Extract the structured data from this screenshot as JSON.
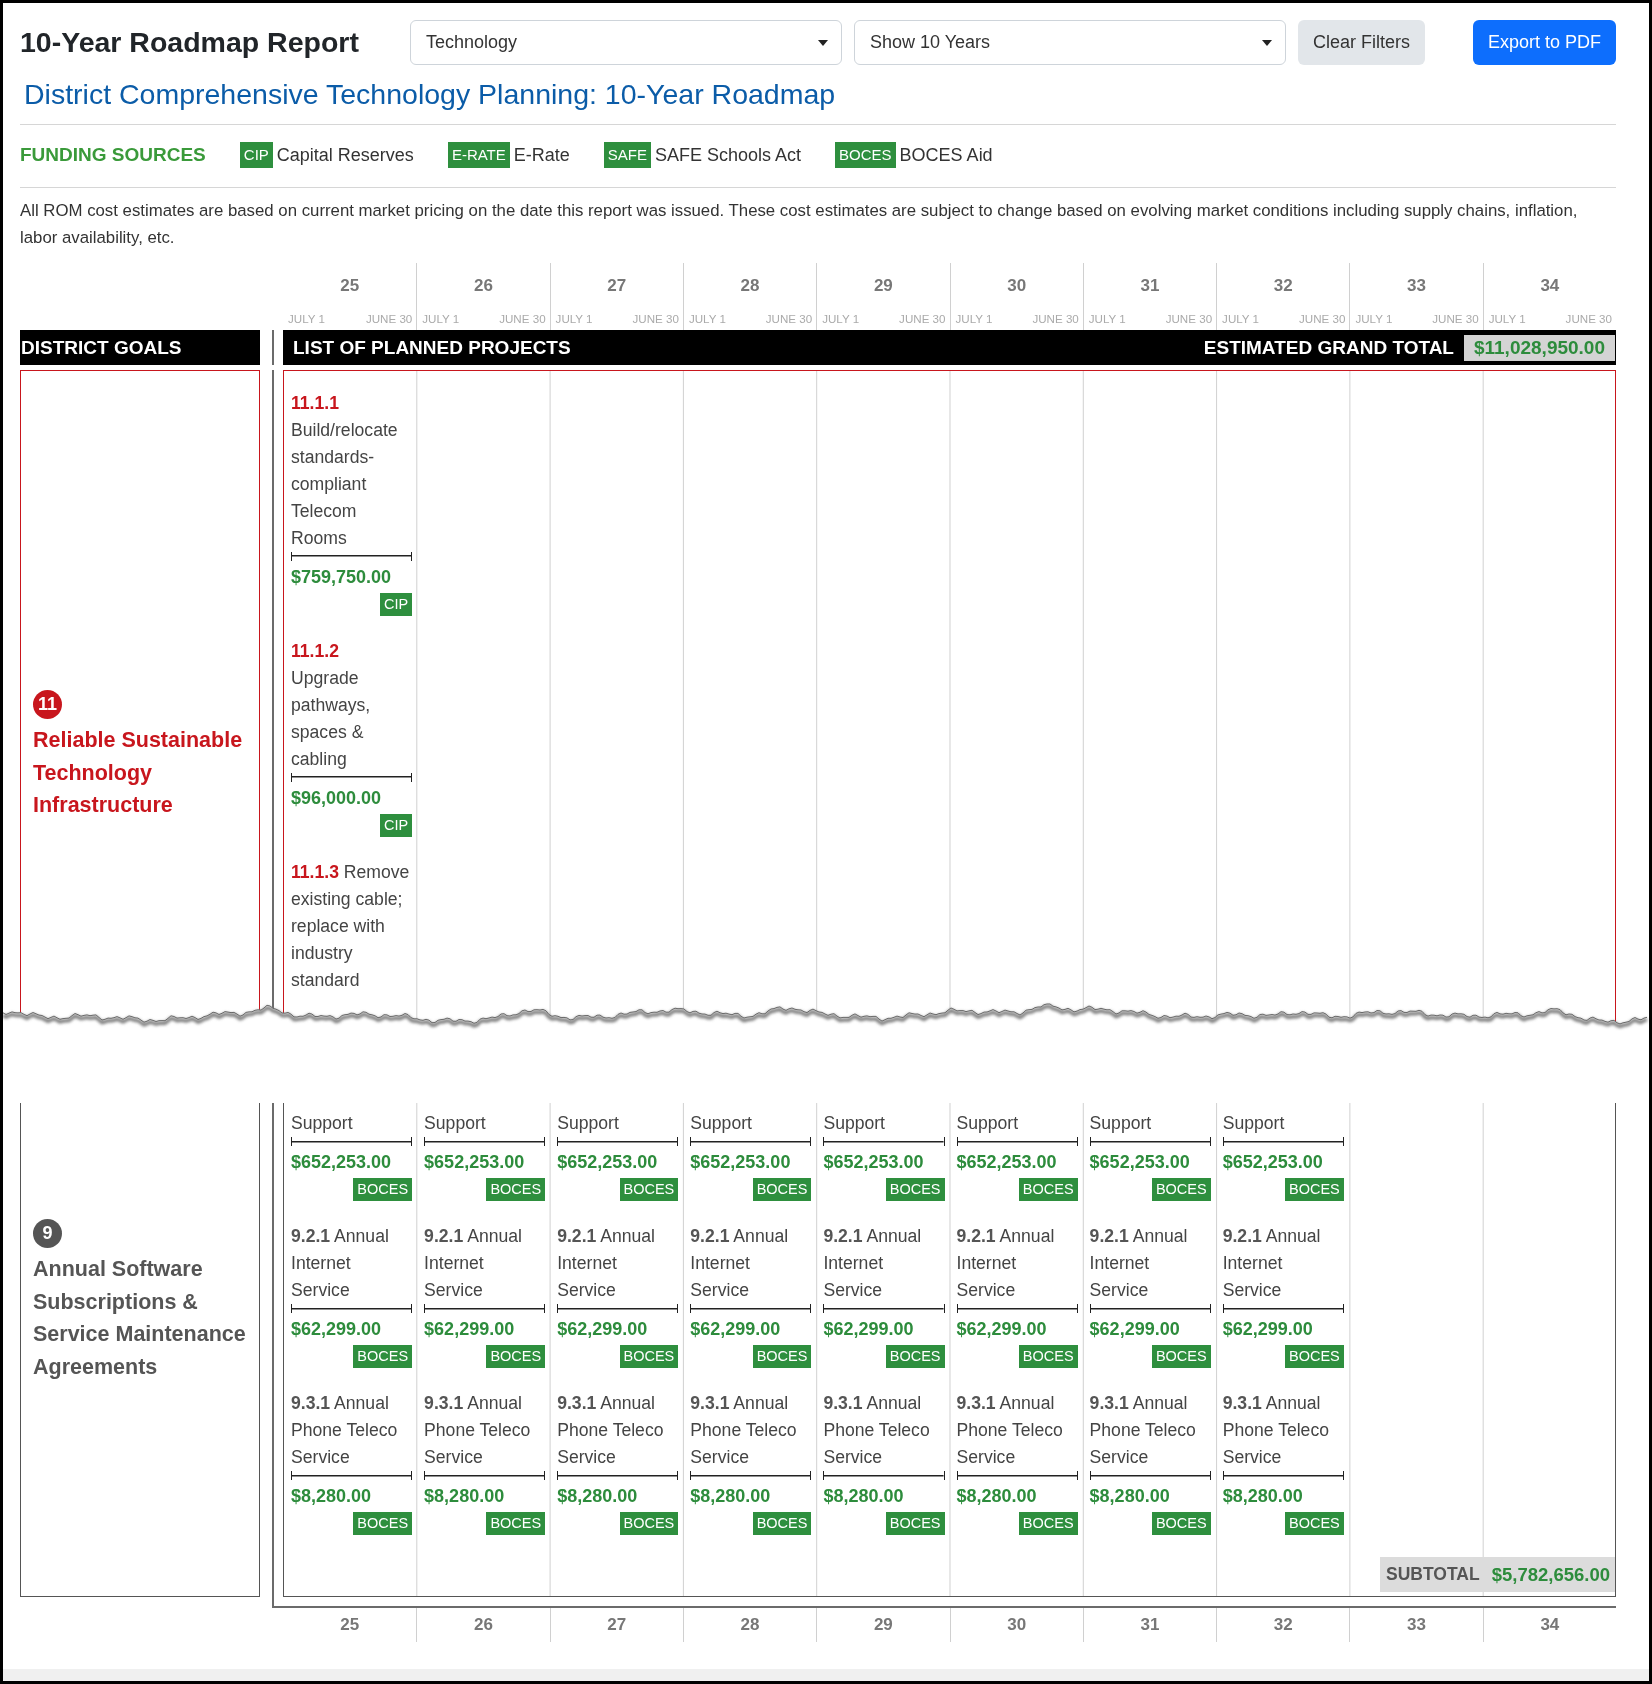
{
  "header": {
    "title": "10-Year Roadmap Report",
    "filters": [
      {
        "value": "Technology"
      },
      {
        "value": "Show 10 Years"
      }
    ],
    "buttons": [
      {
        "label": "Clear Filters",
        "kind": "secondary"
      },
      {
        "label": "Export to PDF",
        "kind": "primary"
      }
    ]
  },
  "subtitle": "District Comprehensive Technology Planning: 10-Year Roadmap",
  "funding_sources": {
    "heading": "FUNDING SOURCES",
    "items": [
      {
        "code": "CIP",
        "name": "Capital Reserves"
      },
      {
        "code": "E-RATE",
        "name": "E-Rate"
      },
      {
        "code": "SAFE",
        "name": "SAFE Schools Act"
      },
      {
        "code": "BOCES",
        "name": "BOCES Aid"
      }
    ]
  },
  "disclaimer": "All ROM cost estimates are based on current market pricing on the date this report was issued. These cost estimates are subject to change based on evolving market conditions including supply chains, inflation, labor availability, etc.",
  "timeline": [
    {
      "year": "25",
      "start": "JULY 1",
      "end": "JUNE 30"
    },
    {
      "year": "26",
      "start": "JULY 1",
      "end": "JUNE 30"
    },
    {
      "year": "27",
      "start": "JULY 1",
      "end": "JUNE 30"
    },
    {
      "year": "28",
      "start": "JULY 1",
      "end": "JUNE 30"
    },
    {
      "year": "29",
      "start": "JULY 1",
      "end": "JUNE 30"
    },
    {
      "year": "30",
      "start": "JULY 1",
      "end": "JUNE 30"
    },
    {
      "year": "31",
      "start": "JULY 1",
      "end": "JUNE 30"
    },
    {
      "year": "32",
      "start": "JULY 1",
      "end": "JUNE 30"
    },
    {
      "year": "33",
      "start": "JULY 1",
      "end": "JUNE 30"
    },
    {
      "year": "34",
      "start": "JULY 1",
      "end": "JUNE 30"
    }
  ],
  "table_header": {
    "goals_heading": "DISTRICT GOALS",
    "projects_heading": "LIST OF PLANNED PROJECTS",
    "grand_total_label": "ESTIMATED GRAND TOTAL",
    "grand_total": "$11,028,950.00"
  },
  "goals": [
    {
      "number": "11",
      "title": "Reliable Sustainable Technology Infrastructure",
      "color": "#c8161d",
      "columns": [
        {
          "projects": [
            {
              "id": "11.1.1",
              "title": "Build/relocate standards-compliant Telecom Rooms",
              "cost": "$759,750.00",
              "source": "CIP"
            },
            {
              "id": "11.1.2",
              "title": "Upgrade pathways, spaces & cabling",
              "cost": "$96,000.00",
              "source": "CIP"
            },
            {
              "id": "11.1.3",
              "title": "Remove existing cable; replace with industry standard"
            }
          ]
        }
      ]
    },
    {
      "number": "9",
      "title": "Annual Software Subscriptions & Service Maintenance Agreements",
      "color": "#555555",
      "columns": [
        {
          "projects": [
            {
              "title": "Support",
              "cost": "$652,253.00",
              "source": "BOCES"
            },
            {
              "id": "9.2.1",
              "title": "Annual Internet Service",
              "cost": "$62,299.00",
              "source": "BOCES"
            },
            {
              "id": "9.3.1",
              "title": "Annual Phone Teleco Service",
              "cost": "$8,280.00",
              "source": "BOCES"
            }
          ]
        },
        {
          "projects": [
            {
              "title": "Support",
              "cost": "$652,253.00",
              "source": "BOCES"
            },
            {
              "id": "9.2.1",
              "title": "Annual Internet Service",
              "cost": "$62,299.00",
              "source": "BOCES"
            },
            {
              "id": "9.3.1",
              "title": "Annual Phone Teleco Service",
              "cost": "$8,280.00",
              "source": "BOCES"
            }
          ]
        },
        {
          "projects": [
            {
              "title": "Support",
              "cost": "$652,253.00",
              "source": "BOCES"
            },
            {
              "id": "9.2.1",
              "title": "Annual Internet Service",
              "cost": "$62,299.00",
              "source": "BOCES"
            },
            {
              "id": "9.3.1",
              "title": "Annual Phone Teleco Service",
              "cost": "$8,280.00",
              "source": "BOCES"
            }
          ]
        },
        {
          "projects": [
            {
              "title": "Support",
              "cost": "$652,253.00",
              "source": "BOCES"
            },
            {
              "id": "9.2.1",
              "title": "Annual Internet Service",
              "cost": "$62,299.00",
              "source": "BOCES"
            },
            {
              "id": "9.3.1",
              "title": "Annual Phone Teleco Service",
              "cost": "$8,280.00",
              "source": "BOCES"
            }
          ]
        },
        {
          "projects": [
            {
              "title": "Support",
              "cost": "$652,253.00",
              "source": "BOCES"
            },
            {
              "id": "9.2.1",
              "title": "Annual Internet Service",
              "cost": "$62,299.00",
              "source": "BOCES"
            },
            {
              "id": "9.3.1",
              "title": "Annual Phone Teleco Service",
              "cost": "$8,280.00",
              "source": "BOCES"
            }
          ]
        },
        {
          "projects": [
            {
              "title": "Support",
              "cost": "$652,253.00",
              "source": "BOCES"
            },
            {
              "id": "9.2.1",
              "title": "Annual Internet Service",
              "cost": "$62,299.00",
              "source": "BOCES"
            },
            {
              "id": "9.3.1",
              "title": "Annual Phone Teleco Service",
              "cost": "$8,280.00",
              "source": "BOCES"
            }
          ]
        },
        {
          "projects": [
            {
              "title": "Support",
              "cost": "$652,253.00",
              "source": "BOCES"
            },
            {
              "id": "9.2.1",
              "title": "Annual Internet Service",
              "cost": "$62,299.00",
              "source": "BOCES"
            },
            {
              "id": "9.3.1",
              "title": "Annual Phone Teleco Service",
              "cost": "$8,280.00",
              "source": "BOCES"
            }
          ]
        },
        {
          "projects": [
            {
              "title": "Support",
              "cost": "$652,253.00",
              "source": "BOCES"
            },
            {
              "id": "9.2.1",
              "title": "Annual Internet Service",
              "cost": "$62,299.00",
              "source": "BOCES"
            },
            {
              "id": "9.3.1",
              "title": "Annual Phone Teleco Service",
              "cost": "$8,280.00",
              "source": "BOCES"
            }
          ]
        }
      ],
      "subtotal": {
        "label": "SUBTOTAL",
        "value": "$5,782,656.00"
      }
    }
  ],
  "footer_years": [
    "25",
    "26",
    "27",
    "28",
    "29",
    "30",
    "31",
    "32",
    "33",
    "34"
  ]
}
